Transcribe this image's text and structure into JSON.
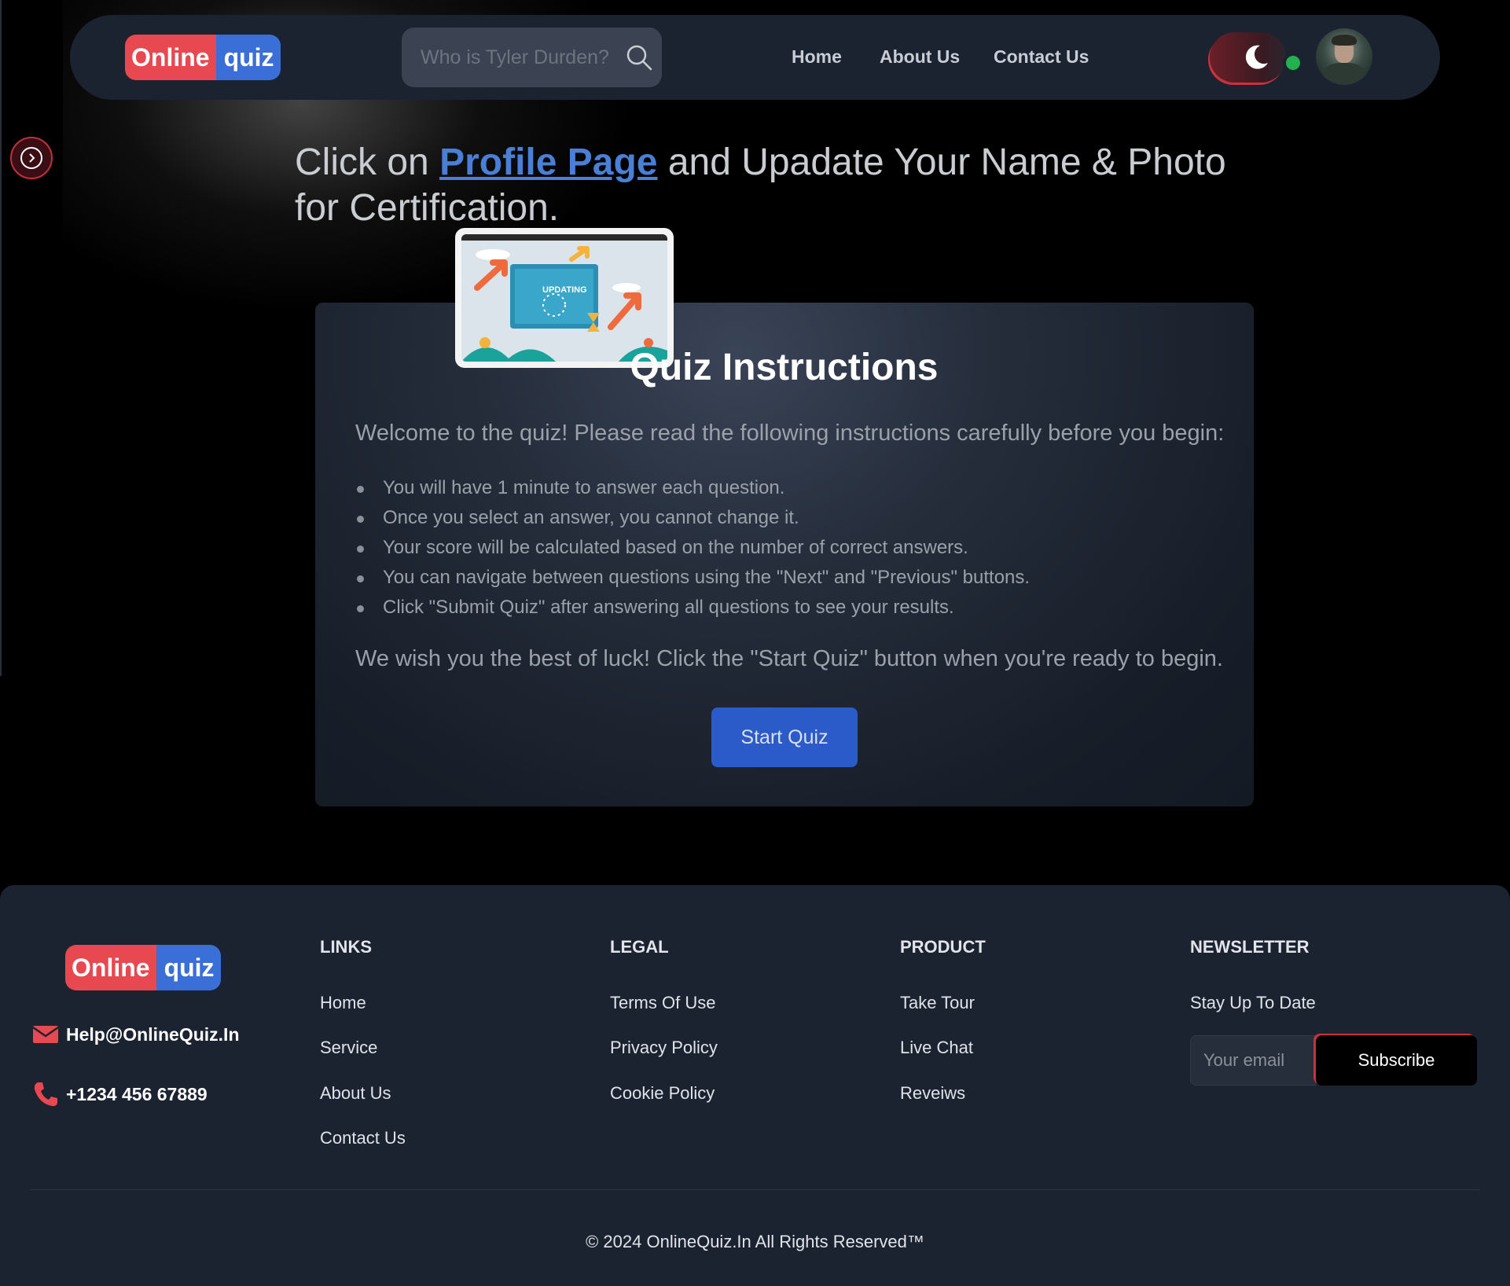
{
  "header": {
    "logo": {
      "part1": "Online",
      "part2": "quiz"
    },
    "search": {
      "placeholder": "Who is Tyler Durden?"
    },
    "nav": {
      "home": "Home",
      "about": "About Us",
      "contact": "Contact Us"
    },
    "theme_icon": "moon-icon",
    "avatar_status": "online"
  },
  "notice": {
    "prefix": "Click on ",
    "link": "Profile Page",
    "suffix": " and Upadate Your Name & Photo for Certification."
  },
  "card": {
    "illustration_text": "UPDATING",
    "title": "Quiz Instructions",
    "intro": "Welcome to the quiz! Please read the following instructions carefully before you begin:",
    "rules": [
      "You will have 1 minute to answer each question.",
      "Once you select an answer, you cannot change it.",
      "Your score will be calculated based on the number of correct answers.",
      "You can navigate between questions using the \"Next\" and \"Previous\" buttons.",
      "Click \"Submit Quiz\" after answering all questions to see your results."
    ],
    "outro": "We wish you the best of luck! Click the \"Start Quiz\" button when you're ready to begin.",
    "start_button": "Start Quiz"
  },
  "footer": {
    "logo": {
      "part1": "Online",
      "part2": "quiz"
    },
    "email": "Help@OnlineQuiz.In",
    "phone": "+1234 456 67889",
    "links": {
      "title": "LINKS",
      "items": [
        "Home",
        "Service",
        "About Us",
        "Contact Us"
      ]
    },
    "legal": {
      "title": "LEGAL",
      "items": [
        "Terms Of Use",
        "Privacy Policy",
        "Cookie Policy"
      ]
    },
    "product": {
      "title": "PRODUCT",
      "items": [
        "Take Tour",
        "Live Chat",
        "Reveiws"
      ]
    },
    "newsletter": {
      "title": "NEWSLETTER",
      "label": "Stay Up To Date",
      "placeholder": "Your email",
      "button": "Subscribe"
    },
    "copyright": "© 2024 OnlineQuiz.In All Rights Reserved™"
  },
  "colors": {
    "logo_red": "#e8484f",
    "logo_blue": "#3a6fd8",
    "accent_blue": "#2a5bc8",
    "status_green": "#22b14c",
    "panel": "#1b2230"
  }
}
